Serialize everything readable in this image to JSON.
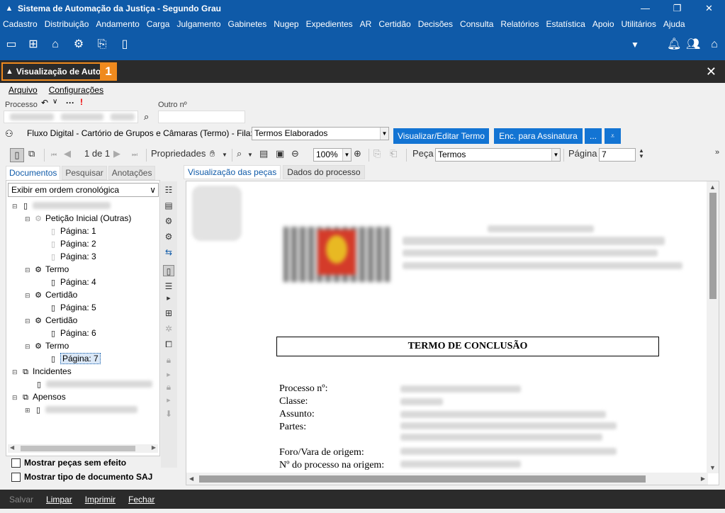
{
  "window": {
    "title": "Sistema de Automação da Justiça - Segundo Grau"
  },
  "menu": [
    "Cadastro",
    "Distribuição",
    "Andamento",
    "Carga",
    "Julgamento",
    "Gabinetes",
    "Nugep",
    "Expedientes",
    "AR",
    "Certidão",
    "Decisões",
    "Consulta",
    "Relatórios",
    "Estatística",
    "Apoio",
    "Utilitários",
    "Ajuda"
  ],
  "app_tab": {
    "label": "Visualização de Autos",
    "badge": "1"
  },
  "submenu": {
    "arquivo": "Arquivo",
    "configuracoes": "Configurações"
  },
  "processo": {
    "label": "Processo",
    "outro_label": "Outro nº",
    "flag": "!"
  },
  "fluxo": {
    "text": "Fluxo Digital - Cartório de Grupos e Câmaras (Termo) - Fila:",
    "fila": "Termos Elaborados",
    "btn_visualizar": "Visualizar/Editar Termo",
    "btn_enc": "Enc. para Assinatura",
    "btn_more": "..."
  },
  "toolbar": {
    "page_of": "1 de 1",
    "propriedades": "Propriedades",
    "zoom": "100%",
    "peca_label": "Peça",
    "peca_value": "Termos",
    "pagina_label": "Página",
    "pagina_value": "7"
  },
  "left_tabs": [
    "Documentos",
    "Pesquisar",
    "Anotações"
  ],
  "order_select": "Exibir em ordem cronológica",
  "tree": [
    {
      "label": "Petição Inicial (Outras)"
    },
    {
      "label": "Página: 1"
    },
    {
      "label": "Página: 2"
    },
    {
      "label": "Página: 3"
    },
    {
      "label": "Termo"
    },
    {
      "label": "Página: 4"
    },
    {
      "label": "Certidão"
    },
    {
      "label": "Página: 5"
    },
    {
      "label": "Certidão"
    },
    {
      "label": "Página: 6"
    },
    {
      "label": "Termo"
    },
    {
      "label": "Página: 7"
    },
    {
      "label": "Incidentes"
    },
    {
      "label": "Apensos"
    }
  ],
  "checkboxes": {
    "sem_efeito": "Mostrar peças sem efeito",
    "tipo_doc": "Mostrar tipo de documento SAJ"
  },
  "view_tabs": [
    "Visualização das peças",
    "Dados do processo"
  ],
  "document": {
    "heading": "TERMO DE CONCLUSÃO",
    "fields": [
      "Processo nº:",
      "Classe:",
      "Assunto:",
      "Partes:",
      "Foro/Vara de origem:",
      "Nº do processo na origem:"
    ]
  },
  "bottom": {
    "salvar": "Salvar",
    "limpar": "Limpar",
    "imprimir": "Imprimir",
    "fechar": "Fechar"
  },
  "colors": {
    "blue": "#0f5aa8",
    "dark": "#2b2b2b",
    "orange": "#ef8a1e",
    "button": "#1374d3"
  }
}
